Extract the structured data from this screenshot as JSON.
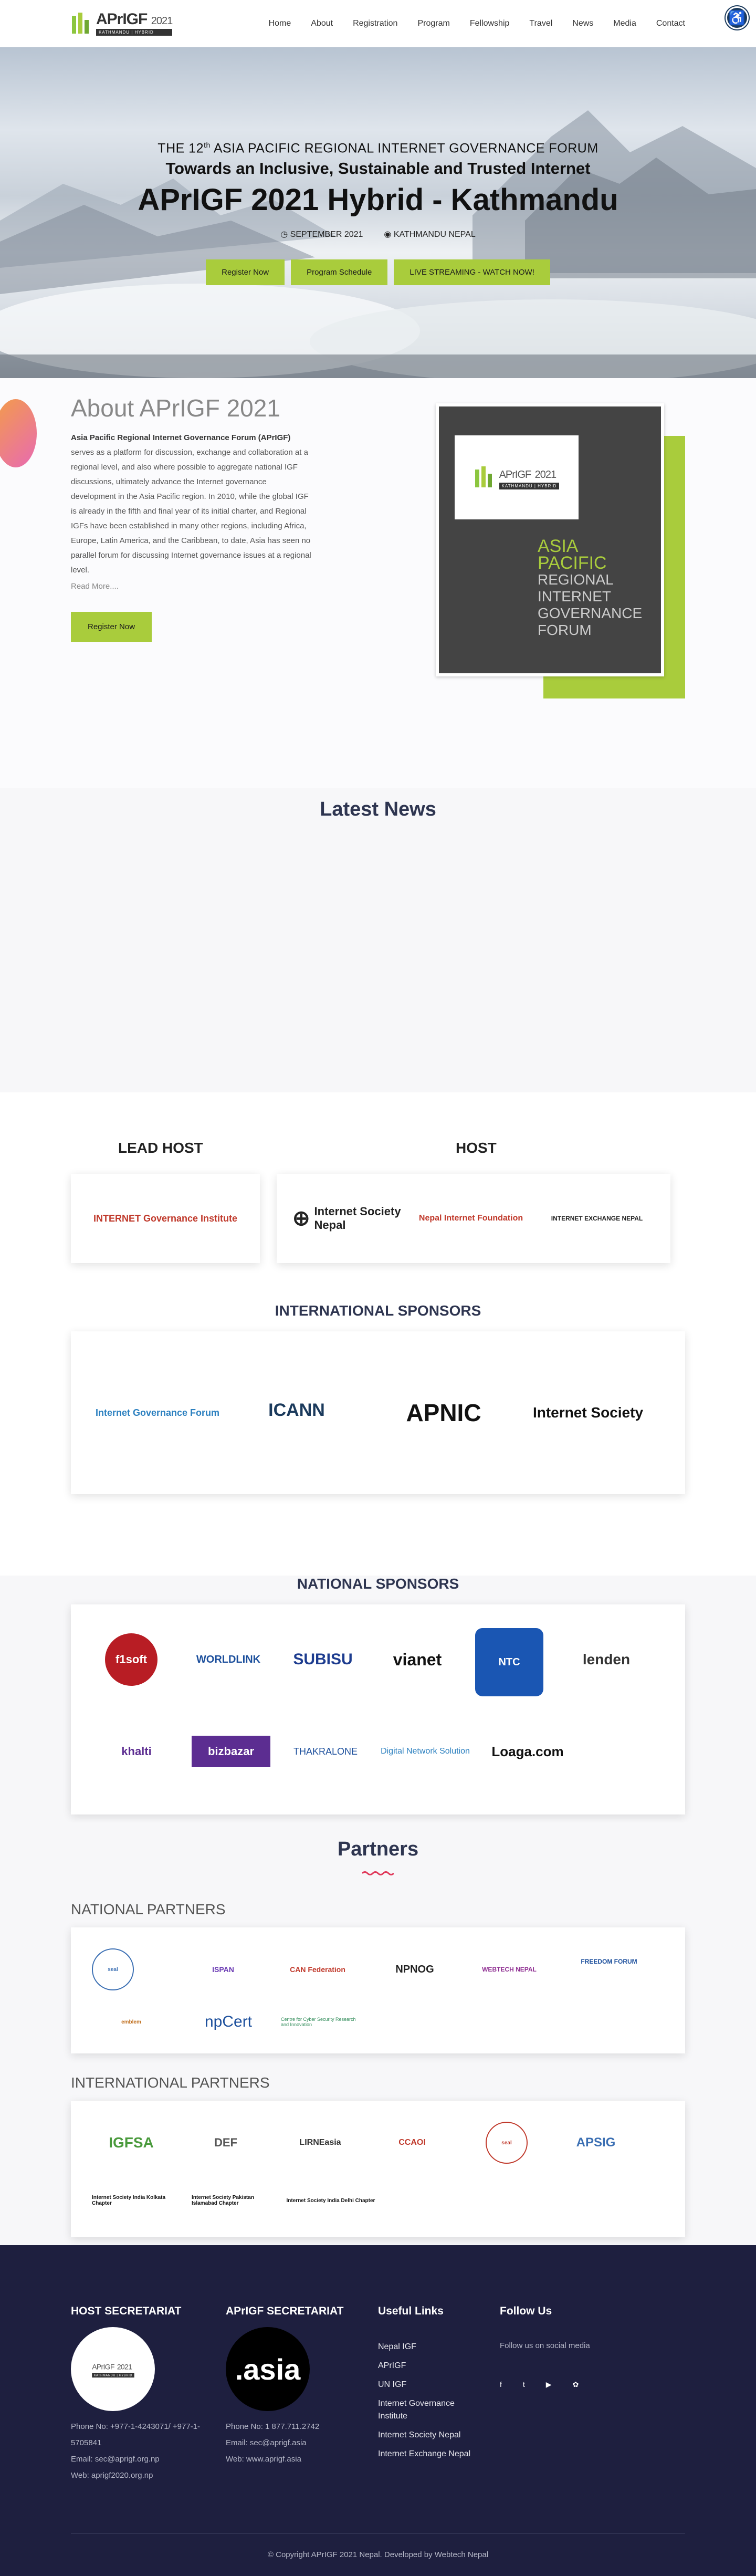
{
  "header": {
    "logo_title": "APrIGF",
    "logo_year": "2021",
    "logo_sub": "KATHMANDU | HYBRID",
    "nav": [
      "Home",
      "About",
      "Registration",
      "Program",
      "Fellowship",
      "Travel",
      "News",
      "Media",
      "Contact"
    ]
  },
  "hero": {
    "pre_prefix": "THE 12",
    "pre_sup": "th",
    "pre_suffix": " ASIA PACIFIC REGIONAL INTERNET GOVERNANCE FORUM",
    "subtitle": "Towards an Inclusive, Sustainable and Trusted Internet",
    "title": "APrIGF 2021 Hybrid - Kathmandu",
    "date": "SEPTEMBER 2021",
    "location": "KATHMANDU NEPAL",
    "buttons": [
      "Register Now",
      "Program Schedule",
      "LIVE STREAMING - WATCH NOW!"
    ]
  },
  "about": {
    "heading": "About APrIGF 2021",
    "bold": "Asia Pacific Regional Internet Governance Forum (APrIGF)",
    "body": " serves as a platform for discussion, exchange and collaboration at a regional level, and also where possible to aggregate national IGF discussions, ultimately advance the Internet governance development in the Asia Pacific region. In 2010, while the global IGF is already in the fifth and final year of its initial charter, and Regional IGFs have been established in many other regions, including Africa, Europe, Latin America, and the Caribbean, to date, Asia has seen no parallel forum for discussing Internet governance issues at a regional level.",
    "read_more": "Read More....",
    "button": "Register Now",
    "card_line1": "ASIA",
    "card_line2": "PACIFIC",
    "card_line3": "REGIONAL",
    "card_line4": "INTERNET",
    "card_line5": "GOVERNANCE",
    "card_line6": "FORUM"
  },
  "news": {
    "heading": "Latest News"
  },
  "hosts": {
    "lead_title": "LEAD HOST",
    "host_title": "HOST",
    "lead_logo": "INTERNET Governance Institute",
    "host_logos": [
      "Internet Society Nepal",
      "Nepal Internet Foundation",
      "INTERNET EXCHANGE NEPAL"
    ]
  },
  "intl_sponsors": {
    "title": "INTERNATIONAL SPONSORS",
    "logos": [
      "Internet Governance Forum",
      "ICANN",
      "APNIC",
      "Internet Society"
    ]
  },
  "national_sponsors": {
    "title": "NATIONAL SPONSORS",
    "row1": [
      "f1soft",
      "WORLDLINK",
      "SUBISU",
      "vianet",
      "NTC",
      "lenden"
    ],
    "row2": [
      "khalti",
      "bizbazar",
      "THAKRALONE",
      "Digital Network Solution",
      "Loaga.com"
    ]
  },
  "partners": {
    "title": "Partners",
    "national_title": "NATIONAL PARTNERS",
    "national_row1": [
      "seal",
      "ISPAN",
      "CAN Federation",
      "NPNOG",
      "WEBTECH NEPAL",
      "FREEDOM FORUM"
    ],
    "national_row2": [
      "emblem",
      "npCert",
      "Centre for Cyber Security Research and Innovation"
    ],
    "international_title": "INTERNATIONAL PARTNERS",
    "intl_row1": [
      "IGFSA",
      "DEF",
      "LIRNEasia",
      "CCAOI",
      "seal",
      "APSIG"
    ],
    "intl_row2": [
      "Internet Society India Kolkata Chapter",
      "Internet Society Pakistan Islamabad Chapter",
      "Internet Society India Delhi Chapter"
    ]
  },
  "footer": {
    "host_title": "HOST SECRETARIAT",
    "host_phone": "Phone No: +977-1-4243071/ +977-1-5705841",
    "host_email": "Email: sec@aprigf.org.np",
    "host_web": "Web: aprigf2020.org.np",
    "apr_title": "APrIGF SECRETARIAT",
    "apr_circle": ".asia",
    "apr_phone": "Phone No: 1 877.711.2742",
    "apr_email": "Email: sec@aprigf.asia",
    "apr_web": "Web: www.aprigf.asia",
    "links_title": "Useful Links",
    "links": [
      "Nepal IGF",
      "APrIGF",
      "UN IGF",
      "Internet Governance Institute",
      "Internet Society Nepal",
      "Internet Exchange Nepal"
    ],
    "follow_title": "Follow Us",
    "follow_text": "Follow us on social media",
    "social": [
      "f",
      "t",
      "▶",
      "✿"
    ],
    "copyright": "© Copyright APrIGF 2021 Nepal. Developed by Webtech Nepal"
  },
  "colors": {
    "accent": "#a9cc3c",
    "dark_navy": "#1e1f3f",
    "heading": "#2e3550"
  }
}
